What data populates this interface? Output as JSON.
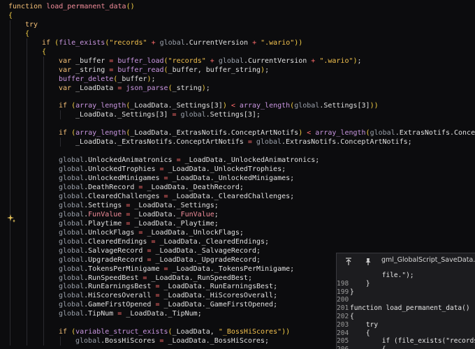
{
  "editor": {
    "lines": [
      {
        "indent": 0,
        "tokens": [
          [
            "kw",
            "function "
          ],
          [
            "fn",
            "load_permanent_data"
          ],
          [
            "br",
            "()"
          ]
        ]
      },
      {
        "indent": 0,
        "tokens": [
          [
            "br",
            "{"
          ]
        ]
      },
      {
        "indent": 1,
        "tokens": [
          [
            "kw",
            "try"
          ]
        ]
      },
      {
        "indent": 1,
        "tokens": [
          [
            "br",
            "{"
          ]
        ]
      },
      {
        "indent": 2,
        "tokens": [
          [
            "kw",
            "if "
          ],
          [
            "br",
            "("
          ],
          [
            "fb",
            "file_exists"
          ],
          [
            "br",
            "("
          ],
          [
            "str",
            "\"records\""
          ],
          [
            "op",
            " + "
          ],
          [
            "gl",
            "global"
          ],
          [
            "tx",
            ".CurrentVersion"
          ],
          [
            "op",
            " + "
          ],
          [
            "str",
            "\".wario\""
          ],
          [
            "br",
            "))"
          ]
        ]
      },
      {
        "indent": 2,
        "tokens": [
          [
            "br",
            "{"
          ]
        ]
      },
      {
        "indent": 3,
        "tokens": [
          [
            "kw",
            "var "
          ],
          [
            "tx",
            "_buffer "
          ],
          [
            "op",
            "= "
          ],
          [
            "fb",
            "buffer_load"
          ],
          [
            "br",
            "("
          ],
          [
            "str",
            "\"records\""
          ],
          [
            "op",
            " + "
          ],
          [
            "gl",
            "global"
          ],
          [
            "tx",
            ".CurrentVersion"
          ],
          [
            "op",
            " + "
          ],
          [
            "str",
            "\".wario\""
          ],
          [
            "br",
            ")"
          ],
          [
            "pn",
            ";"
          ]
        ]
      },
      {
        "indent": 3,
        "tokens": [
          [
            "kw",
            "var "
          ],
          [
            "tx",
            "_string "
          ],
          [
            "op",
            "= "
          ],
          [
            "fb",
            "buffer_read"
          ],
          [
            "br",
            "("
          ],
          [
            "tx",
            "_buffer, buffer_string"
          ],
          [
            "br",
            ")"
          ],
          [
            "pn",
            ";"
          ]
        ]
      },
      {
        "indent": 3,
        "tokens": [
          [
            "fb",
            "buffer_delete"
          ],
          [
            "br",
            "("
          ],
          [
            "tx",
            "_buffer"
          ],
          [
            "br",
            ")"
          ],
          [
            "pn",
            ";"
          ]
        ]
      },
      {
        "indent": 3,
        "tokens": [
          [
            "kw",
            "var "
          ],
          [
            "tx",
            "_LoadData "
          ],
          [
            "op",
            "= "
          ],
          [
            "fb",
            "json_parse"
          ],
          [
            "br",
            "("
          ],
          [
            "tx",
            "_string"
          ],
          [
            "br",
            ")"
          ],
          [
            "pn",
            ";"
          ]
        ]
      },
      {
        "indent": 0,
        "tokens": []
      },
      {
        "indent": 3,
        "tokens": [
          [
            "kw",
            "if "
          ],
          [
            "br",
            "("
          ],
          [
            "fb",
            "array_length"
          ],
          [
            "br",
            "("
          ],
          [
            "tx",
            "_LoadData._Settings[3]"
          ],
          [
            "br",
            ")"
          ],
          [
            "op",
            " < "
          ],
          [
            "fb",
            "array_length"
          ],
          [
            "br",
            "("
          ],
          [
            "gl",
            "global"
          ],
          [
            "tx",
            ".Settings[3]"
          ],
          [
            "br",
            "))"
          ]
        ]
      },
      {
        "indent": 4,
        "tokens": [
          [
            "tx",
            "_LoadData._Settings[3] "
          ],
          [
            "op",
            "= "
          ],
          [
            "gl",
            "global"
          ],
          [
            "tx",
            ".Settings[3];"
          ]
        ]
      },
      {
        "indent": 0,
        "tokens": []
      },
      {
        "indent": 3,
        "tokens": [
          [
            "kw",
            "if "
          ],
          [
            "br",
            "("
          ],
          [
            "fb",
            "array_length"
          ],
          [
            "br",
            "("
          ],
          [
            "tx",
            "_LoadData._ExtrasNotifs.ConceptArtNotifs"
          ],
          [
            "br",
            ")"
          ],
          [
            "op",
            " < "
          ],
          [
            "fb",
            "array_length"
          ],
          [
            "br",
            "("
          ],
          [
            "gl",
            "global"
          ],
          [
            "tx",
            ".ExtrasNotifs.ConceptArtNotifs"
          ],
          [
            "br",
            "))"
          ]
        ]
      },
      {
        "indent": 4,
        "tokens": [
          [
            "tx",
            "_LoadData._ExtrasNotifs.ConceptArtNotifs "
          ],
          [
            "op",
            "= "
          ],
          [
            "gl",
            "global"
          ],
          [
            "tx",
            ".ExtrasNotifs.ConceptArtNotifs;"
          ]
        ]
      },
      {
        "indent": 0,
        "tokens": []
      },
      {
        "indent": 3,
        "tokens": [
          [
            "gl",
            "global"
          ],
          [
            "tx",
            ".UnlockedAnimatronics "
          ],
          [
            "op",
            "= "
          ],
          [
            "tx",
            "_LoadData._UnlockedAnimatronics;"
          ]
        ]
      },
      {
        "indent": 3,
        "tokens": [
          [
            "gl",
            "global"
          ],
          [
            "tx",
            ".UnlockedTrophies "
          ],
          [
            "op",
            "= "
          ],
          [
            "tx",
            "_LoadData._UnlockedTrophies;"
          ]
        ]
      },
      {
        "indent": 3,
        "tokens": [
          [
            "gl",
            "global"
          ],
          [
            "tx",
            ".UnlockedMinigames "
          ],
          [
            "op",
            "= "
          ],
          [
            "tx",
            "_LoadData._UnlockedMinigames;"
          ]
        ]
      },
      {
        "indent": 3,
        "tokens": [
          [
            "gl",
            "global"
          ],
          [
            "tx",
            ".DeathRecord "
          ],
          [
            "op",
            "= "
          ],
          [
            "tx",
            "_LoadData._DeathRecord;"
          ]
        ]
      },
      {
        "indent": 3,
        "tokens": [
          [
            "gl",
            "global"
          ],
          [
            "tx",
            ".ClearedChallenges "
          ],
          [
            "op",
            "= "
          ],
          [
            "tx",
            "_LoadData._ClearedChallenges;"
          ]
        ]
      },
      {
        "indent": 3,
        "tokens": [
          [
            "gl",
            "global"
          ],
          [
            "tx",
            ".Settings "
          ],
          [
            "op",
            "= "
          ],
          [
            "tx",
            "_LoadData._Settings;"
          ]
        ]
      },
      {
        "indent": 3,
        "tokens": [
          [
            "gl",
            "global"
          ],
          [
            "tx",
            "."
          ],
          [
            "hl",
            "FunValue"
          ],
          [
            "op",
            " = "
          ],
          [
            "tx",
            "_LoadData._"
          ],
          [
            "hl",
            "FunValue"
          ],
          [
            "tx",
            ";"
          ]
        ]
      },
      {
        "indent": 3,
        "tokens": [
          [
            "gl",
            "global"
          ],
          [
            "tx",
            ".Playtime "
          ],
          [
            "op",
            "= "
          ],
          [
            "tx",
            "_LoadData._Playtime;"
          ]
        ]
      },
      {
        "indent": 3,
        "tokens": [
          [
            "gl",
            "global"
          ],
          [
            "tx",
            ".UnlockFlags "
          ],
          [
            "op",
            "= "
          ],
          [
            "tx",
            "_LoadData._UnlockFlags;"
          ]
        ]
      },
      {
        "indent": 3,
        "tokens": [
          [
            "gl",
            "global"
          ],
          [
            "tx",
            ".ClearedEndings "
          ],
          [
            "op",
            "= "
          ],
          [
            "tx",
            "_LoadData._ClearedEndings;"
          ]
        ]
      },
      {
        "indent": 3,
        "tokens": [
          [
            "gl",
            "global"
          ],
          [
            "tx",
            ".SalvageRecord "
          ],
          [
            "op",
            "= "
          ],
          [
            "tx",
            "_LoadData._SalvageRecord;"
          ]
        ]
      },
      {
        "indent": 3,
        "tokens": [
          [
            "gl",
            "global"
          ],
          [
            "tx",
            ".UpgradeRecord "
          ],
          [
            "op",
            "= "
          ],
          [
            "tx",
            "_LoadData._UpgradeRecord;"
          ]
        ]
      },
      {
        "indent": 3,
        "tokens": [
          [
            "gl",
            "global"
          ],
          [
            "tx",
            ".TokensPerMinigame "
          ],
          [
            "op",
            "= "
          ],
          [
            "tx",
            "_LoadData._TokensPerMinigame;"
          ]
        ]
      },
      {
        "indent": 3,
        "tokens": [
          [
            "gl",
            "global"
          ],
          [
            "tx",
            ".RunSpeedBest "
          ],
          [
            "op",
            "= "
          ],
          [
            "tx",
            "_LoadData._RunSpeedBest;"
          ]
        ]
      },
      {
        "indent": 3,
        "tokens": [
          [
            "gl",
            "global"
          ],
          [
            "tx",
            ".RunEarningsBest "
          ],
          [
            "op",
            "= "
          ],
          [
            "tx",
            "_LoadData._RunEarningsBest;"
          ]
        ]
      },
      {
        "indent": 3,
        "tokens": [
          [
            "gl",
            "global"
          ],
          [
            "tx",
            ".HiScoresOverall "
          ],
          [
            "op",
            "= "
          ],
          [
            "tx",
            "_LoadData._HiScoresOverall;"
          ]
        ]
      },
      {
        "indent": 3,
        "tokens": [
          [
            "gl",
            "global"
          ],
          [
            "tx",
            ".GameFirstOpened "
          ],
          [
            "op",
            "= "
          ],
          [
            "tx",
            "_LoadData._GameFirstOpened;"
          ]
        ]
      },
      {
        "indent": 3,
        "tokens": [
          [
            "gl",
            "global"
          ],
          [
            "tx",
            ".TipNum "
          ],
          [
            "op",
            "= "
          ],
          [
            "tx",
            "_LoadData._TipNum;"
          ]
        ]
      },
      {
        "indent": 0,
        "tokens": []
      },
      {
        "indent": 3,
        "tokens": [
          [
            "kw",
            "if "
          ],
          [
            "br",
            "("
          ],
          [
            "fb",
            "variable_struct_exists"
          ],
          [
            "br",
            "("
          ],
          [
            "tx",
            "_LoadData, "
          ],
          [
            "str",
            "\"_BossHiScores\""
          ],
          [
            "br",
            "))"
          ]
        ]
      },
      {
        "indent": 4,
        "tokens": [
          [
            "gl",
            "global"
          ],
          [
            "tx",
            ".BossHiScores "
          ],
          [
            "op",
            "= "
          ],
          [
            "tx",
            "_LoadData._BossHiScores;"
          ]
        ]
      }
    ],
    "gutter_icon": "sparkle-icon"
  },
  "peek": {
    "title": "gml_GlobalScript_SaveData.gml",
    "icons": [
      "collapse-up-icon",
      "pin-icon"
    ],
    "lines": [
      {
        "num": "",
        "code": "        file.\");"
      },
      {
        "num": "198",
        "code": "    }"
      },
      {
        "num": "199",
        "code": "}"
      },
      {
        "num": "200",
        "code": ""
      },
      {
        "num": "201",
        "code": "function load_permanent_data()"
      },
      {
        "num": "202",
        "code": "{"
      },
      {
        "num": "203",
        "code": "    try"
      },
      {
        "num": "204",
        "code": "    {"
      },
      {
        "num": "205",
        "code": "        if (file_exists(\"records_t"
      },
      {
        "num": "206",
        "code": "        {"
      }
    ]
  }
}
